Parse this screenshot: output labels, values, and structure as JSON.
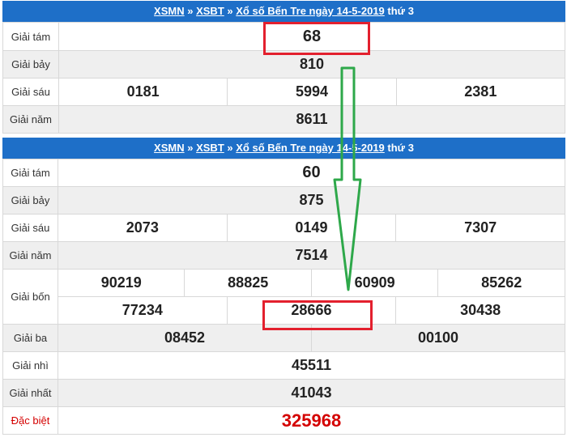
{
  "top": {
    "header": {
      "link1": "XSMN",
      "sep1": "»",
      "link2": "XSBT",
      "sep2": "»",
      "link3": "Xổ số Bến Tre ngày 14-5-2019",
      "suffix": "thứ 3"
    },
    "labels": [
      "Giải tám",
      "Giải bảy",
      "Giải sáu",
      "Giải năm"
    ],
    "g8": "68",
    "g7": "810",
    "g6": [
      "0181",
      "5994",
      "2381"
    ],
    "g5": "8611"
  },
  "bottom": {
    "header": {
      "link1": "XSMN",
      "sep1": "»",
      "link2": "XSBT",
      "sep2": "»",
      "link3": "Xổ số Bến Tre ngày 14-5-2019",
      "suffix": "thứ 3"
    },
    "labels": [
      "Giải tám",
      "Giải bảy",
      "Giải sáu",
      "Giải năm",
      "Giải bốn",
      "Giải ba",
      "Giải nhì",
      "Giải nhất",
      "Đặc biệt"
    ],
    "g8": "60",
    "g7": "875",
    "g6": [
      "2073",
      "0149",
      "7307"
    ],
    "g5": "7514",
    "g4": [
      "90219",
      "88825",
      "60909",
      "85262",
      "77234",
      "28666",
      "30438"
    ],
    "g3": [
      "08452",
      "00100"
    ],
    "g2": "45511",
    "g1": "41043",
    "db": "325968"
  },
  "colors": {
    "header_bg": "#1e6fc8",
    "highlight": "#e3202e",
    "arrow": "#2ea84a",
    "special": "#d40000"
  }
}
